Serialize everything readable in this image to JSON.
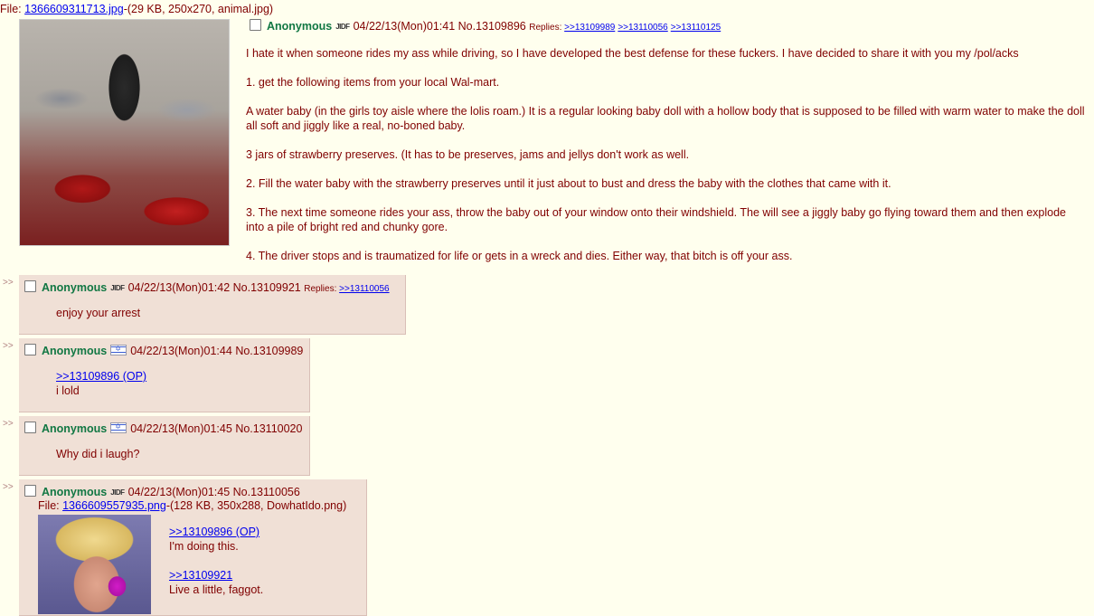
{
  "op": {
    "file_label": "File: ",
    "file_link": "1366609311713.jpg",
    "file_meta": "-(29 KB, 250x270, animal.jpg)",
    "name": "Anonymous",
    "flag": "JIDF",
    "datetime": "04/22/13(Mon)01:41",
    "number": "No.13109896",
    "replies_label": "Replies:",
    "replies": [
      ">>13109989",
      ">>13110056",
      ">>13110125"
    ],
    "body": [
      "I hate it when someone rides my ass while driving, so I have developed the best defense for these fuckers. I have decided to share it with you my /pol/acks",
      "1. get the following items from your local Wal-mart.",
      "A water baby (in the girls toy aisle where the lolis roam.) It is a regular looking baby doll with a hollow body that is supposed to be filled with warm water to make the doll all soft and jiggly like a real, no-boned baby.",
      "3 jars of strawberry preserves. (It has to be preserves, jams and jellys don't work as well.",
      "2. Fill the water baby with the strawberry preserves until it just about to bust and dress the baby with the clothes that came with it.",
      "3. The next time someone rides your ass, throw the baby out of your window onto their windshield. The will see a jiggly baby go flying toward them and then explode into a pile of bright red and chunky gore.",
      "4. The driver stops and is traumatized for life or gets in a wreck and dies. Either way, that bitch is off your ass."
    ]
  },
  "arrows": ">>",
  "replies": [
    {
      "name": "Anonymous",
      "flag": "JIDF",
      "datetime": "04/22/13(Mon)01:42",
      "number": "No.13109921",
      "replies_label": "Replies:",
      "replies": [
        ">>13110056"
      ],
      "lines": [
        "enjoy your arrest"
      ]
    },
    {
      "name": "Anonymous",
      "flag": "israel-flag",
      "datetime": "04/22/13(Mon)01:44",
      "number": "No.13109989",
      "quote": ">>13109896 (OP)",
      "lines": [
        "i lold"
      ]
    },
    {
      "name": "Anonymous",
      "flag": "israel-flag",
      "datetime": "04/22/13(Mon)01:45",
      "number": "No.13110020",
      "lines": [
        "Why did i laugh?"
      ]
    },
    {
      "name": "Anonymous",
      "flag": "JIDF",
      "datetime": "04/22/13(Mon)01:45",
      "number": "No.13110056",
      "file_label": "File: ",
      "file_link": "1366609557935.png",
      "file_meta": "-(128 KB, 350x288, DowhatIdo.png)",
      "quote1": ">>13109896 (OP)",
      "line1": "I'm doing this.",
      "quote2": ">>13109921",
      "line2": "Live a little, faggot."
    }
  ]
}
